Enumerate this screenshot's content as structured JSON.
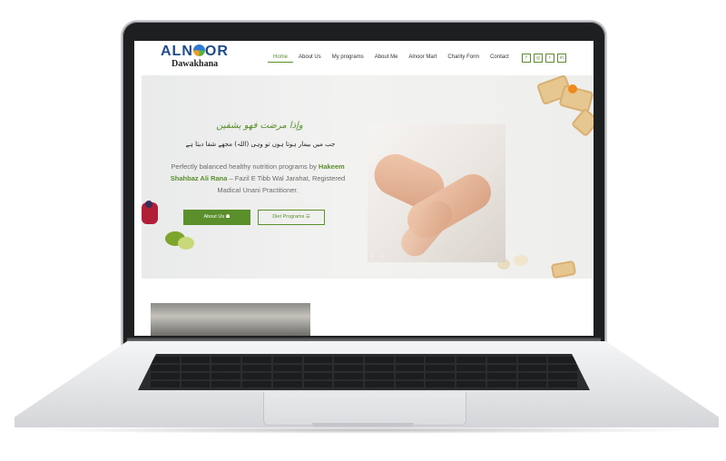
{
  "site": {
    "logo_main": "ALN",
    "logo_main_tail": "OR",
    "logo_sub": "Dawakhana"
  },
  "nav": {
    "items": [
      "Home",
      "About Us",
      "My programs",
      "About Me",
      "Alnoor Mart",
      "Charity Form",
      "Contact"
    ],
    "active": "Home"
  },
  "social": [
    "facebook-icon",
    "instagram-icon",
    "twitter-icon",
    "linkedin-icon"
  ],
  "social_glyphs": [
    "f",
    "◎",
    "t",
    "in"
  ],
  "hero": {
    "quote_arabic": "وإذا مرضت فهو يشفين",
    "quote_urdu": "جب میں بیمار ہوتا ہوں تو وہی (اللہ) مجھے شفا دیتا ہے",
    "text_before": "Perfectly balanced healthy nutrition programs by ",
    "name": "Hakeem Shahbaz Ali Rana",
    "text_after": " – Fazil E Tibb Wal Jarahat, Registered Madical Unani Practitioner.",
    "btn_about": "About Us",
    "btn_diet": "Diet Programs",
    "slider_prev": "‹",
    "slider_next": "›"
  },
  "colors": {
    "accent": "#5a8f2c",
    "logo_blue": "#1d4b8f"
  }
}
